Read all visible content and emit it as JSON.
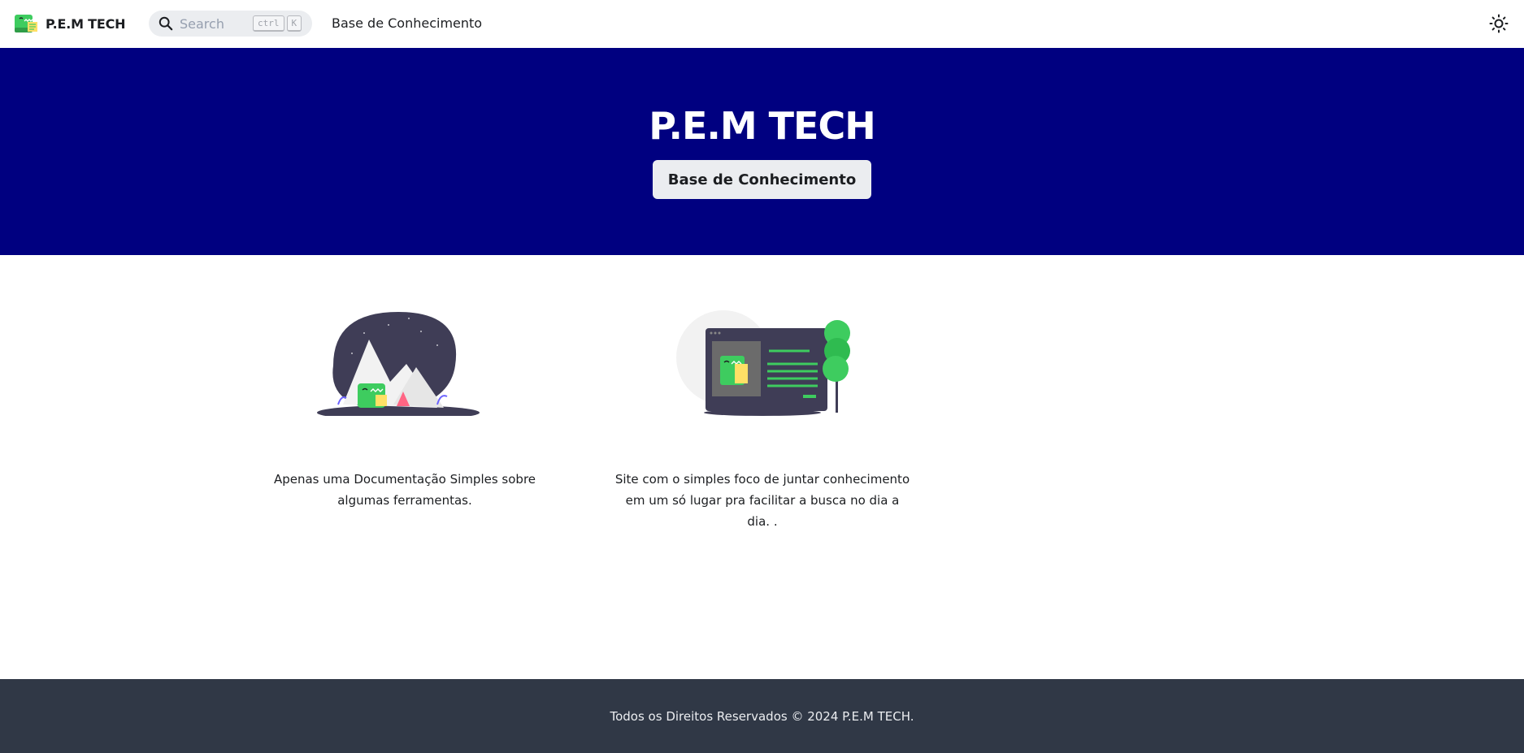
{
  "navbar": {
    "brand_title": "P.E.M TECH",
    "search_placeholder": "Search",
    "search_key_1": "ctrl",
    "search_key_2": "K",
    "nav_link": "Base de Conhecimento",
    "icons": {
      "search": "search-icon",
      "theme": "sun-icon",
      "logo": "dinosaur-logo"
    }
  },
  "hero": {
    "title": "P.E.M TECH",
    "button_label": "Base de Conhecimento",
    "background_color": "#000080"
  },
  "features": [
    {
      "illustration": "mountain-camp-illustration",
      "text": "Apenas uma Documentação Simples sobre algumas ferramentas."
    },
    {
      "illustration": "browser-tree-illustration",
      "text": "Site com o simples foco de juntar conhecimento em um só lugar pra facilitar a busca no dia a dia. ."
    }
  ],
  "footer": {
    "text": "Todos os Direitos Reservados © 2024 P.E.M TECH.",
    "background_color": "#303846"
  }
}
